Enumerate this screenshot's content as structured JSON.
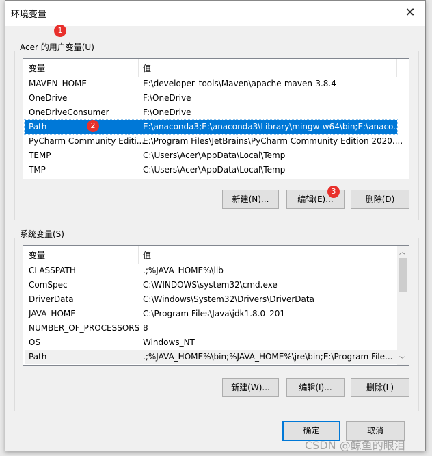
{
  "window": {
    "title": "环境变量",
    "close_icon": "close-icon"
  },
  "user_vars": {
    "label": "Acer 的用户变量(U)",
    "headers": [
      "变量",
      "值"
    ],
    "rows": [
      {
        "name": "MAVEN_HOME",
        "value": "E:\\developer_tools\\Maven\\apache-maven-3.8.4"
      },
      {
        "name": "OneDrive",
        "value": "F:\\OneDrive"
      },
      {
        "name": "OneDriveConsumer",
        "value": "F:\\OneDrive"
      },
      {
        "name": "Path",
        "value": "E:\\anaconda3;E:\\anaconda3\\Library\\mingw-w64\\bin;E:\\anaco...",
        "selected": true
      },
      {
        "name": "PyCharm Community Editi...",
        "value": "E:\\Program Files\\JetBrains\\PyCharm Community Edition 2020...."
      },
      {
        "name": "TEMP",
        "value": "C:\\Users\\Acer\\AppData\\Local\\Temp"
      },
      {
        "name": "TMP",
        "value": "C:\\Users\\Acer\\AppData\\Local\\Temp"
      }
    ],
    "buttons": {
      "new": "新建(N)...",
      "edit": "编辑(E)...",
      "delete": "删除(D)"
    }
  },
  "system_vars": {
    "label": "系统变量(S)",
    "headers": [
      "变量",
      "值"
    ],
    "rows": [
      {
        "name": "CLASSPATH",
        "value": ".;%JAVA_HOME%\\lib"
      },
      {
        "name": "ComSpec",
        "value": "C:\\WINDOWS\\system32\\cmd.exe"
      },
      {
        "name": "DriverData",
        "value": "C:\\Windows\\System32\\Drivers\\DriverData"
      },
      {
        "name": "JAVA_HOME",
        "value": "C:\\Program Files\\Java\\jdk1.8.0_201"
      },
      {
        "name": "NUMBER_OF_PROCESSORS",
        "value": "8"
      },
      {
        "name": "OS",
        "value": "Windows_NT"
      },
      {
        "name": "Path",
        "value": ".;%JAVA_HOME%\\bin;%JAVA_HOME%\\jre\\bin;E:\\Program File..."
      }
    ],
    "buttons": {
      "new": "新建(W)...",
      "edit": "编辑(I)...",
      "delete": "删除(L)"
    }
  },
  "footer": {
    "ok": "确定",
    "cancel": "取消"
  },
  "annotations": [
    "1",
    "2",
    "3"
  ],
  "watermark": "CSDN @鲸鱼的眼泪",
  "colors": {
    "selection": "#0078d7",
    "badge": "#e8302c"
  }
}
